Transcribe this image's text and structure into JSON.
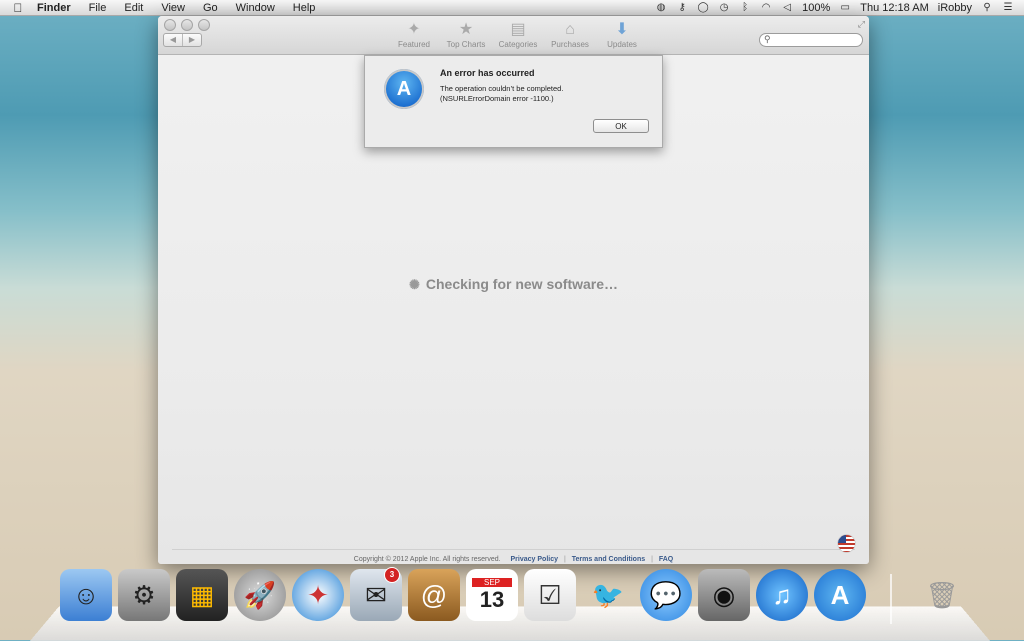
{
  "menubar": {
    "apple_icon": "apple-logo",
    "menus": [
      "Finder",
      "File",
      "Edit",
      "View",
      "Go",
      "Window",
      "Help"
    ],
    "battery": "100%",
    "clock": "Thu 12:18 AM",
    "user": "iRobby"
  },
  "toolbar": {
    "tabs": [
      {
        "label": "Featured",
        "icon": "featured-icon"
      },
      {
        "label": "Top Charts",
        "icon": "star-icon"
      },
      {
        "label": "Categories",
        "icon": "categories-icon"
      },
      {
        "label": "Purchases",
        "icon": "purchases-icon"
      },
      {
        "label": "Updates",
        "icon": "updates-icon"
      }
    ],
    "search_placeholder": ""
  },
  "main": {
    "loading_text": "Checking for new software…"
  },
  "alert": {
    "title": "An error has occurred",
    "message_line1": "The operation couldn’t be completed.",
    "message_line2": "(NSURLErrorDomain error -1100.)",
    "ok_label": "OK"
  },
  "footer": {
    "copyright": "Copyright © 2012 Apple Inc. All rights reserved.",
    "privacy": "Privacy Policy",
    "terms": "Terms and Conditions",
    "faq": "FAQ"
  },
  "dock": {
    "mail_badge": "3",
    "calendar_month": "SEP",
    "calendar_day": "13"
  }
}
